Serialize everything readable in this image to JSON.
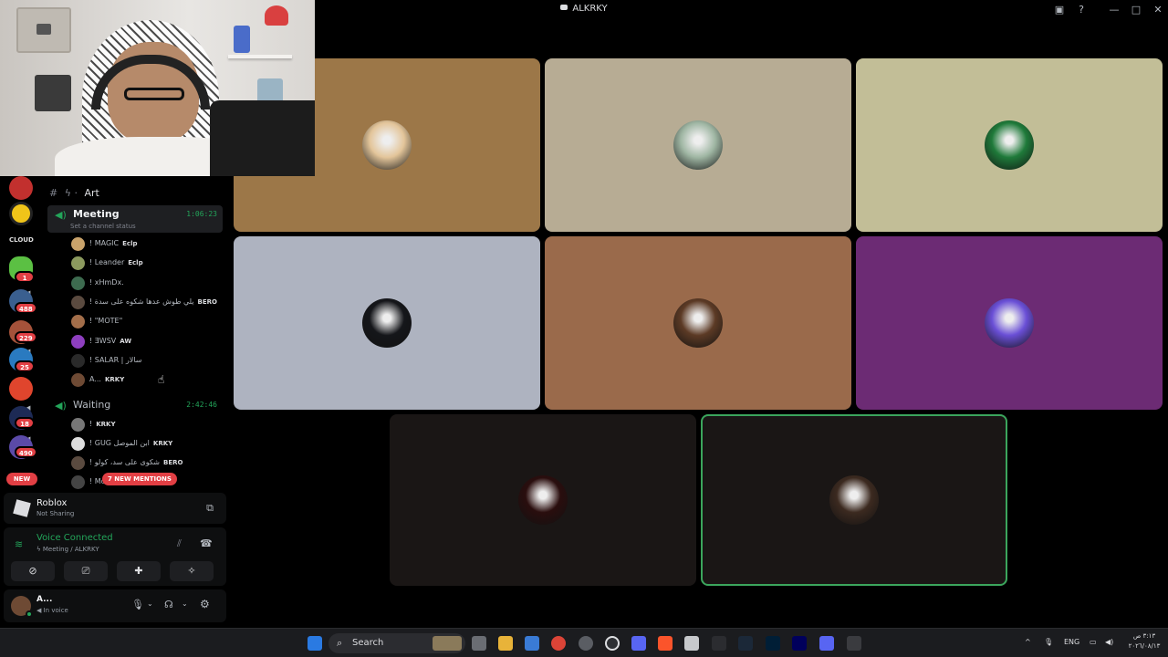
{
  "window": {
    "title": "ALKRKY"
  },
  "channels": {
    "art": "Art",
    "meeting": {
      "name": "Meeting",
      "time": "1:06:23",
      "status": "Set a channel status"
    },
    "meeting_members": [
      {
        "name": "! MAGIC",
        "tag": "Eclp",
        "color": "#c9a36b"
      },
      {
        "name": "! Leander",
        "tag": "Eclp",
        "color": "#8c9a5e"
      },
      {
        "name": "! xHmDx.",
        "tag": "",
        "color": "#3d6b4f"
      },
      {
        "name": "! يلي طوش عدها شكوه على سدة",
        "tag": "BERO",
        "color": "#5a4a3f"
      },
      {
        "name": "! \"MOTE\"",
        "tag": "",
        "color": "#a36e4a"
      },
      {
        "name": "! ƎWSV",
        "tag": "AW",
        "color": "#8e3fbf"
      },
      {
        "name": "! SALAR | سالار",
        "tag": "",
        "color": "#2a2a2a"
      },
      {
        "name": "A...",
        "tag": "KRKY",
        "color": "#6e4a34"
      }
    ],
    "waiting": {
      "name": "Waiting",
      "time": "2:42:46"
    },
    "waiting_members": [
      {
        "name": "!",
        "tag": "KRKY",
        "color": "#777"
      },
      {
        "name": "! GUG ابن الموصل",
        "tag": "KRKY",
        "color": "#ddd"
      },
      {
        "name": "! شكوى على سد، كولو",
        "tag": "BERO",
        "color": "#5a4a3f"
      },
      {
        "name": "! Mo...",
        "tag": "",
        "color": "#444"
      }
    ],
    "mentions_label": "7 NEW MENTIONS"
  },
  "rail": {
    "badges": [
      "1",
      "488",
      "229",
      "25",
      "18",
      "490"
    ],
    "new_label": "NEW",
    "cloud_label": "CLOUD"
  },
  "activity": {
    "app": "Roblox",
    "status": "Not Sharing"
  },
  "voice": {
    "label": "Voice Connected",
    "channel": "Meeting / ALKRKY"
  },
  "user": {
    "name": "A...",
    "status": "In voice"
  },
  "tiles": [
    {
      "bg": "#9c7748",
      "pfp": "#e3c59a"
    },
    {
      "bg": "#b7ac94",
      "pfp": "#9fb6a3"
    },
    {
      "bg": "#c2be97",
      "pfp": "#1f7a3a"
    },
    {
      "bg": "#aeb3c0",
      "pfp": "#15161a"
    },
    {
      "bg": "#9a6a4b",
      "pfp": "#5c3a25"
    },
    {
      "bg": "#6c2b74",
      "pfp": "#6a4fd6"
    },
    {
      "bg": "#1a1615",
      "pfp": "#2a0e0e"
    },
    {
      "bg": "#1a1615",
      "pfp": "#3c2a20"
    }
  ],
  "taskbar": {
    "search": "Search",
    "lang": "ENG",
    "time": "٣:١٣ ص",
    "date": "٢٠٢٦/٠٨/١٣"
  }
}
